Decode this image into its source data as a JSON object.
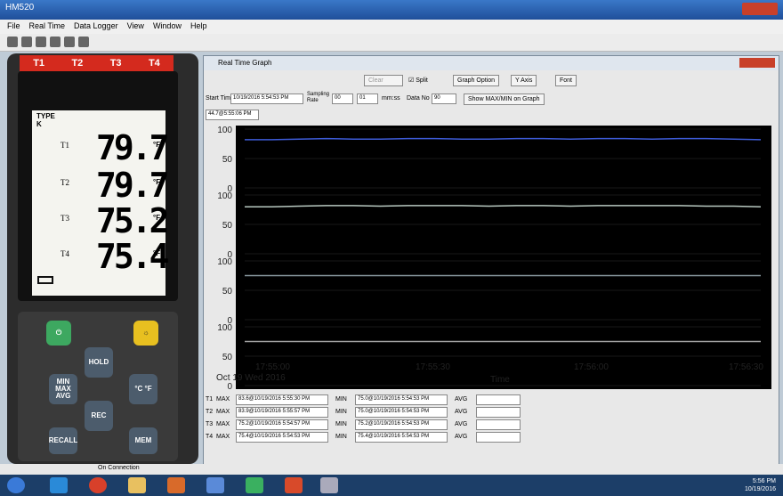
{
  "window": {
    "title": "HM520"
  },
  "menu": [
    "File",
    "Real Time",
    "Data Logger",
    "View",
    "Window",
    "Help"
  ],
  "device": {
    "channels": [
      "T1",
      "T2",
      "T3",
      "T4"
    ],
    "type_label": "TYPE",
    "type_value": "K",
    "readings": [
      {
        "label": "T1",
        "value": "79.7",
        "unit": "°F"
      },
      {
        "label": "T2",
        "value": "79.7",
        "unit": "°F"
      },
      {
        "label": "T3",
        "value": "75.2",
        "unit": "°F"
      },
      {
        "label": "T4",
        "value": "75.4",
        "unit": "°F"
      }
    ],
    "keys": {
      "hold": "HOLD",
      "minmax": "MIN MAX AVG",
      "unit": "°C °F",
      "rec": "REC",
      "recall": "RECALL",
      "mem": "MEM"
    }
  },
  "graph": {
    "title": "Real Time Graph",
    "split_label": "Split",
    "buttons": {
      "graph_option": "Graph Option",
      "yaxis": "Y Axis",
      "font": "Font",
      "show_minmax": "Show MAX/MIN on Graph",
      "clear": "Clear"
    },
    "start_time_label": "Start Time",
    "start_time": "10/19/2016 5:54:53 PM",
    "sampling_label": "Sampling Rate",
    "sampling_h": "00",
    "sampling_m": "01",
    "sampling_unit": "mm:ss",
    "datano_label": "Data No",
    "datano": "90",
    "cursor_readout": "44.7@5:55:06 PM",
    "legend": [
      "T1",
      "T2",
      "T3",
      "T4"
    ],
    "time_label": "Time",
    "date_label": "Oct 19 Wed 2016",
    "stats": [
      {
        "ch": "T1",
        "max": "83.6@10/19/2016 5:55:30 PM",
        "min": "75.0@10/19/2016 5:54:53 PM"
      },
      {
        "ch": "T2",
        "max": "83.9@10/19/2016 5:55:57 PM",
        "min": "75.0@10/19/2016 5:54:53 PM"
      },
      {
        "ch": "T3",
        "max": "75.2@10/19/2016 5:54:57 PM",
        "min": "75.2@10/19/2016 5:54:53 PM"
      },
      {
        "ch": "T4",
        "max": "75.4@10/19/2016 5:54:53 PM",
        "min": "75.4@10/19/2016 5:54:53 PM"
      }
    ],
    "stat_labels": {
      "max": "MAX",
      "min": "MIN",
      "avg": "AVG"
    }
  },
  "chart_data": {
    "type": "line",
    "xlabel": "Time",
    "x_ticks": [
      "17:55:00",
      "17:55:30",
      "17:56:00",
      "17:56:30"
    ],
    "y_ticks": [
      "100",
      "50",
      "0"
    ],
    "ylim": [
      0,
      100
    ],
    "series": [
      {
        "name": "T1",
        "color": "#3d5bd8",
        "values": [
          82,
          82,
          83,
          84,
          83,
          83,
          84,
          84,
          83,
          83,
          84,
          84,
          83,
          84,
          84,
          83,
          84,
          84,
          83,
          82
        ]
      },
      {
        "name": "T2",
        "color": "#b8c8c0",
        "values": [
          80,
          80,
          81,
          82,
          82,
          81,
          82,
          82,
          82,
          81,
          82,
          82,
          81,
          82,
          82,
          82,
          82,
          81,
          81,
          80
        ]
      },
      {
        "name": "T3",
        "color": "#8a9aa0",
        "values": [
          75,
          75,
          75,
          75,
          75,
          75,
          75,
          75,
          75,
          75,
          75,
          75,
          75,
          75,
          75,
          75,
          75,
          75,
          75,
          75
        ]
      },
      {
        "name": "T4",
        "color": "#a0a0a0",
        "values": [
          75,
          75,
          75,
          75,
          75,
          75,
          75,
          75,
          75,
          75,
          75,
          75,
          75,
          75,
          75,
          75,
          75,
          75,
          75,
          75
        ]
      }
    ]
  },
  "statusbar": {
    "text": "On Connection"
  },
  "taskbar": {
    "time": "5:56 PM",
    "date": "10/19/2016"
  }
}
